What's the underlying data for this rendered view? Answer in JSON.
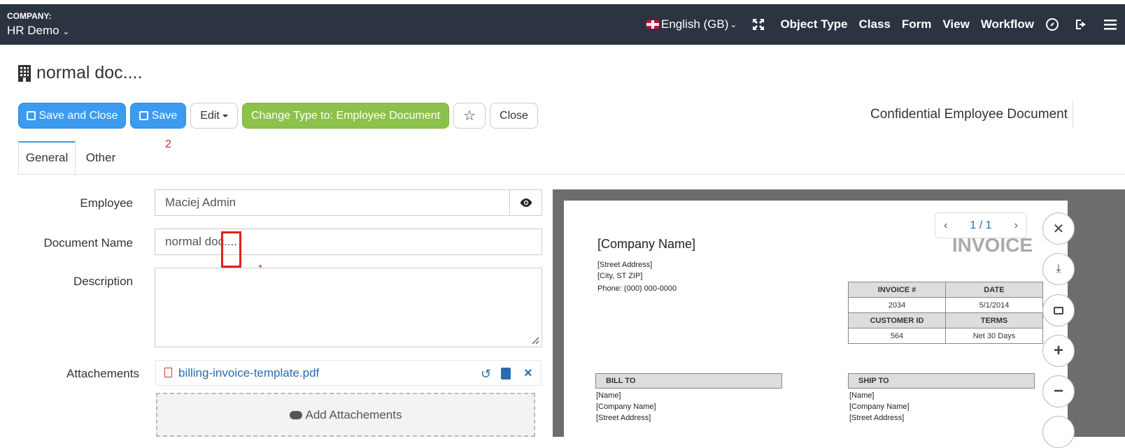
{
  "header": {
    "company_label": "COMPANY:",
    "company_name": "HR Demo",
    "language": "English (GB)",
    "nav_items": [
      "Object Type",
      "Class",
      "Form",
      "View",
      "Workflow"
    ]
  },
  "page": {
    "title": "normal doc....",
    "confidential_label": "Confidential Employee Document"
  },
  "toolbar": {
    "save_close": "Save and Close",
    "save": "Save",
    "edit": "Edit",
    "change_type": "Change Type to: Employee Document",
    "close": "Close"
  },
  "annotations": {
    "one": "1",
    "two": "2"
  },
  "tabs": [
    "General",
    "Other"
  ],
  "form": {
    "employee_label": "Employee",
    "employee_value": "Maciej Admin",
    "docname_label": "Document Name",
    "docname_value": "normal doc....",
    "description_label": "Description",
    "description_value": "",
    "attachments_label": "Attachements",
    "attachment_file": "billing-invoice-template.pdf",
    "add_attachments": "Add Attachements"
  },
  "viewer": {
    "page_indicator": "1 / 1",
    "invoice": {
      "company": "[Company Name]",
      "title": "INVOICE",
      "street": "[Street Address]",
      "city": "[City, ST  ZIP]",
      "phone": "Phone: (000) 000-0000",
      "table": {
        "h1": "INVOICE #",
        "h2": "DATE",
        "v1": "2034",
        "v2": "5/1/2014",
        "h3": "CUSTOMER ID",
        "h4": "TERMS",
        "v3": "564",
        "v4": "Net 30 Days"
      },
      "bill_to": "BILL TO",
      "ship_to": "SHIP TO",
      "bill_lines": [
        "[Name]",
        "[Company Name]",
        "[Street Address]"
      ],
      "ship_lines": [
        "[Name]",
        "[Company Name]",
        "[Street Address]"
      ]
    }
  },
  "colors": {
    "topbar": "#2b3440",
    "primary": "#3a9bf0",
    "success": "#8cc24a",
    "annotation": "#e02020"
  }
}
